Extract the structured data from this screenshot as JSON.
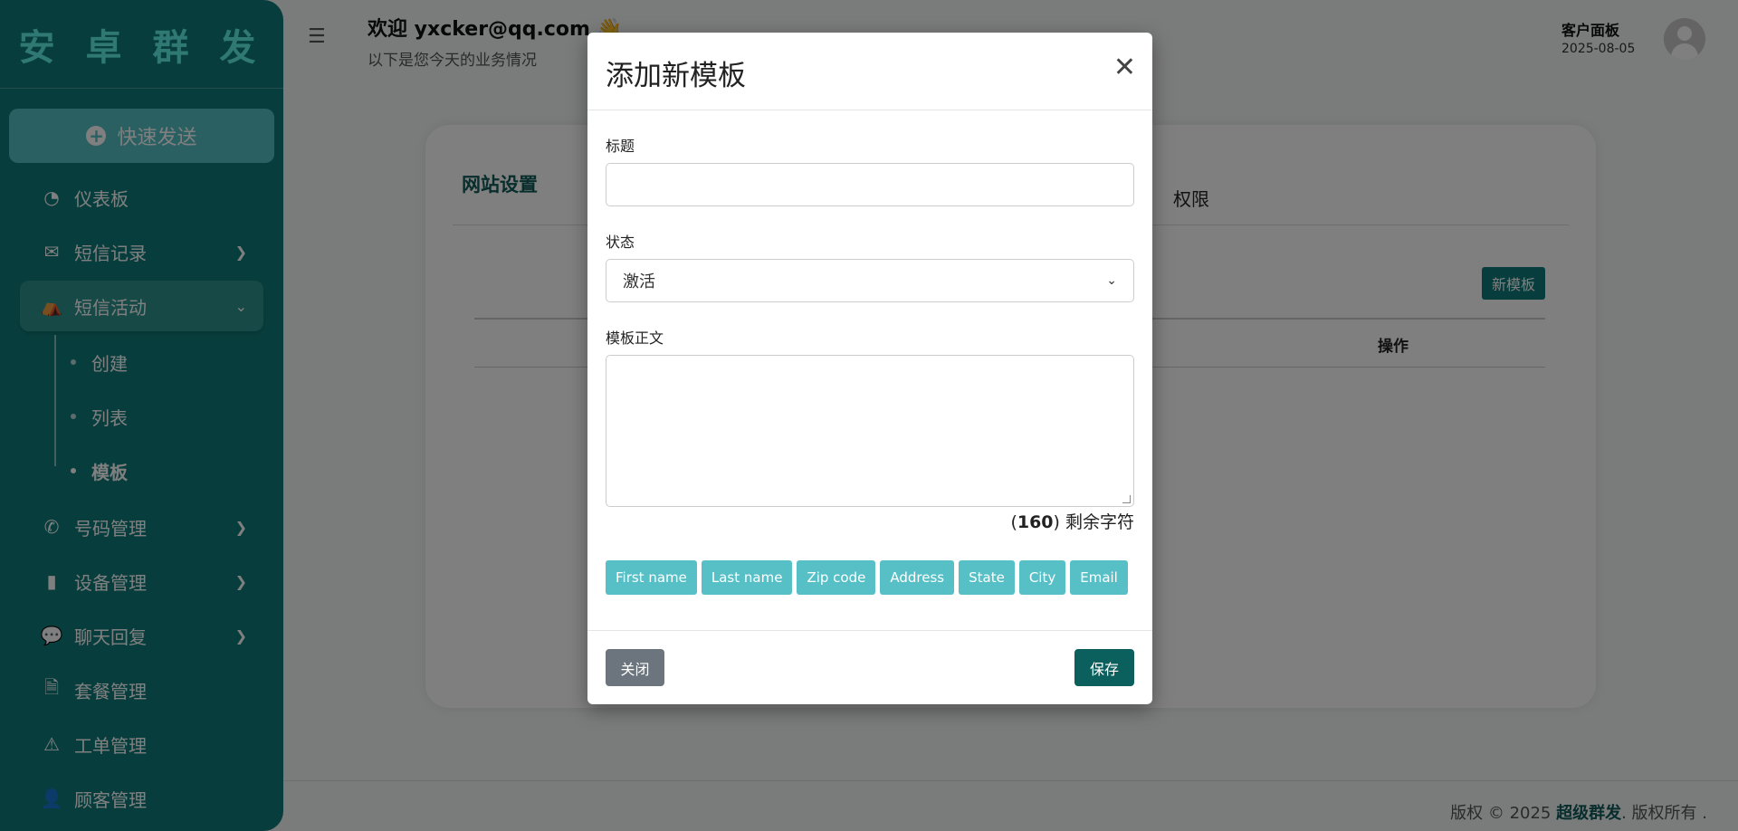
{
  "sidebar": {
    "brand": "安 卓 群 发",
    "quick_send": "快速发送",
    "items": [
      {
        "label": "仪表板",
        "icon": "dashboard-icon",
        "glyph": "◔"
      },
      {
        "label": "短信记录",
        "icon": "envelope-icon",
        "glyph": "✉"
      },
      {
        "label": "短信活动",
        "icon": "campground-icon",
        "glyph": "⛺"
      },
      {
        "label": "号码管理",
        "icon": "phone-icon",
        "glyph": "✆"
      },
      {
        "label": "设备管理",
        "icon": "mobile-icon",
        "glyph": "▮"
      },
      {
        "label": "聊天回复",
        "icon": "sms-icon",
        "glyph": "💬"
      },
      {
        "label": "套餐管理",
        "icon": "invoice-icon",
        "glyph": "🗎"
      },
      {
        "label": "工单管理",
        "icon": "warning-icon",
        "glyph": "⚠"
      },
      {
        "label": "顾客管理",
        "icon": "user-plus-icon",
        "glyph": "👤"
      }
    ],
    "sub_items": [
      "创建",
      "列表",
      "模板"
    ]
  },
  "header": {
    "welcome": "欢迎 yxcker@qq.com 👋",
    "subtitle": "以下是您今天的业务情况",
    "panel_title": "客户面板",
    "date": "2025-08-05"
  },
  "card": {
    "title": "网站设置",
    "perm_tab": "权限",
    "new_template_button": "新模板",
    "ops_header": "操作"
  },
  "footer": {
    "prefix": "版权 © 2025 ",
    "brand": "超级群发",
    "suffix": ". 版权所有 ."
  },
  "modal": {
    "title": "添加新模板",
    "title_label": "标题",
    "title_value": "",
    "status_label": "状态",
    "status_value": "激活",
    "body_label": "模板正文",
    "remaining_count": "160",
    "remaining_suffix": " 剩余字符",
    "tags": [
      "First name",
      "Last name",
      "Zip code",
      "Address",
      "State",
      "City",
      "Email"
    ],
    "close_button": "关闭",
    "save_button": "保存"
  },
  "colors": {
    "sidebar_bg": "#0f7d7a",
    "accent": "#57c0c7",
    "save_button": "#0b5f5c",
    "close_button": "#6c757d"
  }
}
